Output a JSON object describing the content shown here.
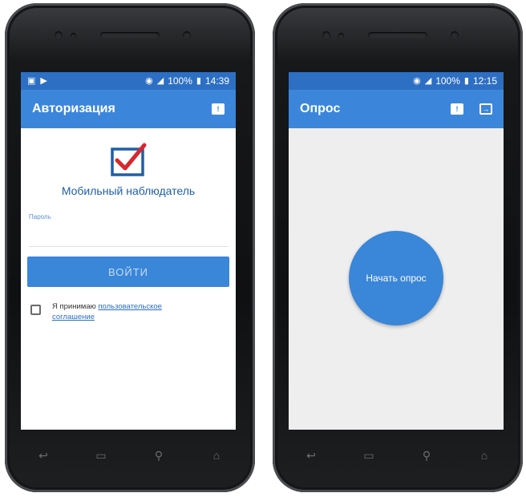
{
  "left_phone": {
    "status": {
      "battery": "100%",
      "time": "14:39"
    },
    "appbar": {
      "title": "Авторизация"
    },
    "app_name": "Мобильный наблюдатель",
    "password_label": "Пароль",
    "login_button": "ВОЙТИ",
    "agreement": {
      "prefix": "Я принимаю ",
      "link": "пользовательское соглашение"
    }
  },
  "right_phone": {
    "status": {
      "battery": "100%",
      "time": "12:15"
    },
    "appbar": {
      "title": "Опрос"
    },
    "start_button": "Начать опрос"
  },
  "colors": {
    "primary": "#3b86db",
    "status_bar": "#2d6fc3",
    "accent_check": "#d6282f",
    "logo_box": "#1f5fa8"
  }
}
